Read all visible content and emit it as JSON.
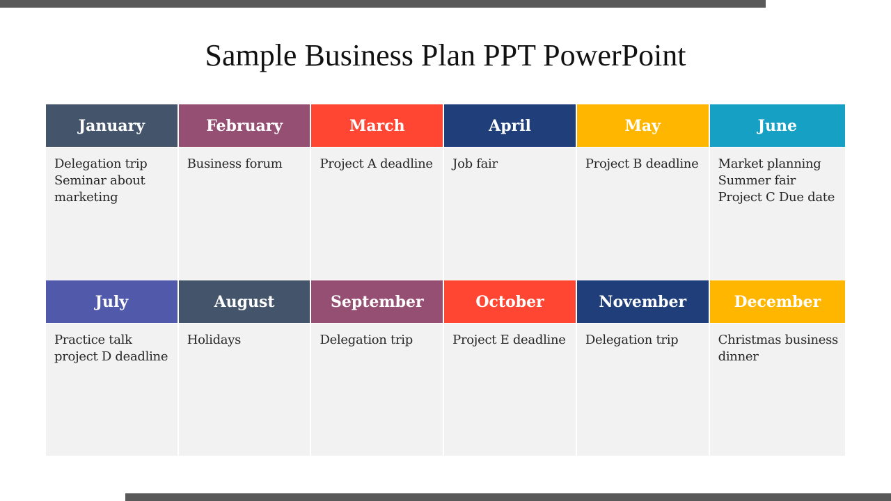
{
  "title": "Sample Business Plan PPT PowerPoint",
  "months": [
    {
      "name": "January",
      "color": "#44546a",
      "lines": [
        "Delegation trip",
        "Seminar about",
        "marketing"
      ]
    },
    {
      "name": "February",
      "color": "#954f72",
      "lines": [
        "Business forum"
      ]
    },
    {
      "name": "March",
      "color": "#ff4633",
      "lines": [
        "Project A deadline"
      ]
    },
    {
      "name": "April",
      "color": "#203f7a",
      "lines": [
        "Job fair"
      ]
    },
    {
      "name": "May",
      "color": "#ffb600",
      "lines": [
        "Project B deadline"
      ]
    },
    {
      "name": "June",
      "color": "#16a0c4",
      "lines": [
        "Market planning",
        "Summer fair",
        "Project C Due date"
      ]
    },
    {
      "name": "July",
      "color": "#5159ab",
      "lines": [
        "Practice talk",
        "project D deadline"
      ]
    },
    {
      "name": "August",
      "color": "#44546a",
      "lines": [
        "Holidays"
      ]
    },
    {
      "name": "September",
      "color": "#954f72",
      "lines": [
        "Delegation trip"
      ]
    },
    {
      "name": "October",
      "color": "#ff4633",
      "lines": [
        "Project E deadline"
      ]
    },
    {
      "name": "November",
      "color": "#203f7a",
      "lines": [
        "Delegation trip"
      ]
    },
    {
      "name": "December",
      "color": "#ffb600",
      "lines": [
        "Christmas business",
        "dinner"
      ]
    }
  ]
}
